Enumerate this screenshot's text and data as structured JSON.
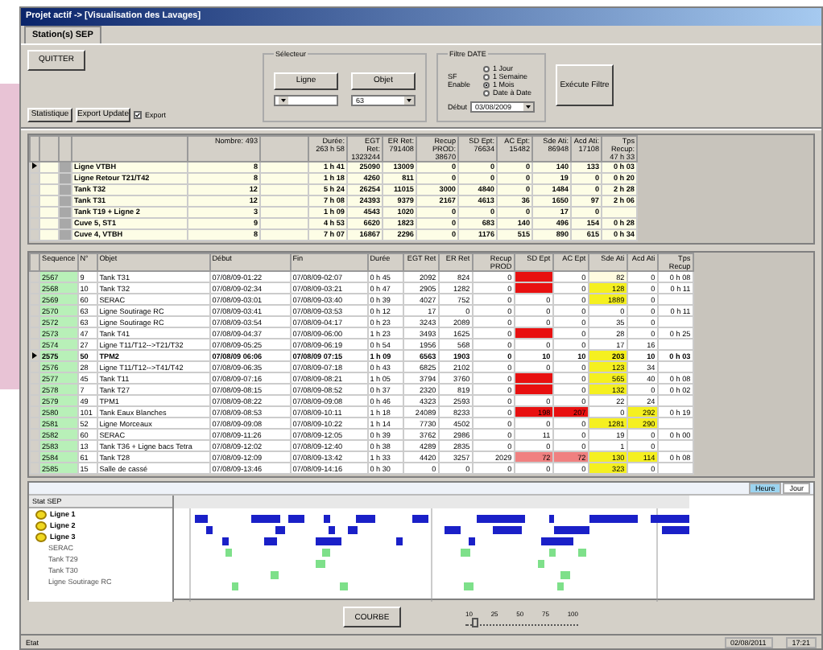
{
  "window": {
    "title": "Projet actif -> [Visualisation des Lavages]"
  },
  "tabs": [
    {
      "label": "Station(s) SEP",
      "selected": true
    }
  ],
  "quit_button": "QUITTER",
  "selector": {
    "title": "Sélecteur",
    "buttons": [
      "Ligne",
      "Objet"
    ],
    "combos": [
      {
        "kind": "blank"
      },
      {
        "kind": "valued",
        "value": "63"
      }
    ]
  },
  "date_filter": {
    "title": "Filtre DATE",
    "enable_label": "SF Enable",
    "options": [
      {
        "label": "1 Jour",
        "selected": false
      },
      {
        "label": "1 Semaine",
        "selected": false
      },
      {
        "label": "1 Mois",
        "selected": true
      },
      {
        "label": "Date à Date",
        "selected": false
      }
    ],
    "start_label": "Début",
    "start_value": "03/08/2009"
  },
  "run_button": "Exécute Filtre",
  "actions": [
    "Statistique",
    "Export Update"
  ],
  "export_checkbox": {
    "label": "Export",
    "checked": true
  },
  "summary_table": {
    "columns": [
      "Nombre: 493",
      "Durée: 263 h 58",
      "EGT Ret: 1323244",
      "ER Ret: 791408",
      "Recup PROD: 38670",
      "SD Ept: 76634",
      "AC Ept: 15482",
      "Sde Ati: 86948",
      "Acd Ati: 17108",
      "Tps Recup: 47 h 33"
    ],
    "rows": [
      {
        "name": "Ligne VTBH",
        "selected": true,
        "values": [
          "8",
          "1 h 41",
          "25090",
          "13009",
          "0",
          "0",
          "0",
          "140",
          "133",
          "0 h 03"
        ]
      },
      {
        "name": "Ligne Retour T21/T42",
        "selected": false,
        "values": [
          "8",
          "1 h 18",
          "4260",
          "811",
          "0",
          "0",
          "0",
          "19",
          "0",
          "0 h 20"
        ]
      },
      {
        "name": "Tank T32",
        "selected": false,
        "values": [
          "12",
          "5 h 24",
          "26254",
          "11015",
          "3000",
          "4840",
          "0",
          "1484",
          "0",
          "2 h 28"
        ]
      },
      {
        "name": "Tank T31",
        "selected": false,
        "values": [
          "12",
          "7 h 08",
          "24393",
          "9379",
          "2167",
          "4613",
          "36",
          "1650",
          "97",
          "2 h 06"
        ]
      },
      {
        "name": "Tank T19 + Ligne 2",
        "selected": false,
        "values": [
          "3",
          "1 h 09",
          "4543",
          "1020",
          "0",
          "0",
          "0",
          "17",
          "0"
        ]
      },
      {
        "name": "Cuve 5, ST1",
        "selected": false,
        "values": [
          "9",
          "4 h 53",
          "6620",
          "1823",
          "0",
          "683",
          "140",
          "496",
          "154",
          "0 h 28"
        ]
      },
      {
        "name": "Cuve 4, VTBH",
        "selected": false,
        "values": [
          "8",
          "7 h 07",
          "16867",
          "2296",
          "0",
          "1176",
          "515",
          "890",
          "615",
          "0 h 34"
        ]
      }
    ]
  },
  "detail_table": {
    "columns": [
      "Sequence",
      "N°",
      "Objet",
      "Début",
      "Fin",
      "Durée",
      "EGT Ret",
      "ER Ret",
      "Recup PROD",
      "SD Ept",
      "AC Ept",
      "Sde Ati",
      "Acd Ati",
      "Tps Recup"
    ],
    "rows": [
      {
        "selected": false,
        "cells": [
          "2567",
          "9",
          "Tank T31",
          "07/08/09-01:22",
          "07/08/09-02:07",
          "0 h 45",
          "2092",
          "824",
          "0",
          {
            "color": "#e81010"
          },
          "0",
          {
            "text": "82",
            "color": "#fffbe0"
          },
          "0",
          "0 h 08"
        ]
      },
      {
        "selected": false,
        "cells": [
          "2568",
          "10",
          "Tank T32",
          "07/08/09-02:34",
          "07/08/09-03:21",
          "0 h 47",
          "2905",
          "1282",
          "0",
          {
            "color": "#e81010"
          },
          "0",
          {
            "text": "128",
            "color": "#f5f020"
          },
          "0",
          "0 h 11"
        ]
      },
      {
        "selected": false,
        "cells": [
          "2569",
          "60",
          "SERAC",
          "07/08/09-03:01",
          "07/08/09-03:40",
          "0 h 39",
          "4027",
          "752",
          "0",
          "0",
          "0",
          {
            "text": "1889",
            "color": "#f5f020"
          },
          "0"
        ]
      },
      {
        "selected": false,
        "cells": [
          "2570",
          "63",
          "Ligne Soutirage RC",
          "07/08/09-03:41",
          "07/08/09-03:53",
          "0 h 12",
          "17",
          "0",
          "0",
          "0",
          "0",
          "0",
          "0",
          "0 h 11"
        ]
      },
      {
        "selected": false,
        "cells": [
          "2572",
          "63",
          "Ligne Soutirage RC",
          "07/08/09-03:54",
          "07/08/09-04:17",
          "0 h 23",
          "3243",
          "2089",
          "0",
          "0",
          "0",
          "35",
          "0"
        ]
      },
      {
        "selected": false,
        "cells": [
          "2573",
          "47",
          "Tank T41",
          "07/08/09-04:37",
          "07/08/09-06:00",
          "1 h 23",
          "3493",
          "1625",
          "0",
          {
            "color": "#e81010"
          },
          "0",
          "28",
          "0",
          "0 h 25"
        ]
      },
      {
        "selected": false,
        "cells": [
          "2574",
          "27",
          "Ligne T11/T12-->T21/T32",
          "07/08/09-05:25",
          "07/08/09-06:19",
          "0 h 54",
          "1956",
          "568",
          "0",
          "0",
          "0",
          "17",
          "16"
        ]
      },
      {
        "selected": true,
        "cells": [
          "2575",
          "50",
          "TPM2",
          "07/08/09 06:06",
          "07/08/09 07:15",
          "1 h 09",
          "6563",
          "1903",
          "0",
          "10",
          "10",
          {
            "text": "203",
            "color": "#f5f020"
          },
          "10",
          "0 h 03"
        ]
      },
      {
        "selected": false,
        "cells": [
          "2576",
          "28",
          "Ligne T11/T12-->T41/T42",
          "07/08/09-06:35",
          "07/08/09-07:18",
          "0 h 43",
          "6825",
          "2102",
          "0",
          "0",
          "0",
          {
            "text": "123",
            "color": "#f5f020"
          },
          "34"
        ]
      },
      {
        "selected": false,
        "cells": [
          "2577",
          "45",
          "Tank T11",
          "07/08/09-07:16",
          "07/08/09-08:21",
          "1 h 05",
          "3794",
          "3760",
          "0",
          {
            "color": "#e81010"
          },
          "0",
          {
            "text": "565",
            "color": "#f5f020"
          },
          "40",
          "0 h 08"
        ]
      },
      {
        "selected": false,
        "cells": [
          "2578",
          "7",
          "Tank T27",
          "07/08/09-08:15",
          "07/08/09-08:52",
          "0 h 37",
          "2320",
          "819",
          "0",
          {
            "color": "#e81010"
          },
          "0",
          {
            "text": "132",
            "color": "#f5f020"
          },
          "0",
          "0 h 02"
        ]
      },
      {
        "selected": false,
        "cells": [
          "2579",
          "49",
          "TPM1",
          "07/08/09-08:22",
          "07/08/09-09:08",
          "0 h 46",
          "4323",
          "2593",
          "0",
          "0",
          "0",
          "22",
          "24"
        ]
      },
      {
        "selected": false,
        "cells": [
          "2580",
          "101",
          "Tank Eaux Blanches",
          "07/08/09-08:53",
          "07/08/09-10:11",
          "1 h 18",
          "24089",
          "8233",
          "0",
          {
            "text": "198",
            "color": "#e81010"
          },
          {
            "text": "207",
            "color": "#e81010"
          },
          "0",
          {
            "text": "292",
            "color": "#f5f020"
          },
          "0 h 19"
        ]
      },
      {
        "selected": false,
        "cells": [
          "2581",
          "52",
          "Ligne Morceaux",
          "07/08/09-09:08",
          "07/08/09-10:22",
          "1 h 14",
          "7730",
          "4502",
          "0",
          "0",
          "0",
          {
            "text": "1281",
            "color": "#f5f020"
          },
          {
            "text": "290",
            "color": "#f5f020"
          }
        ]
      },
      {
        "selected": false,
        "cells": [
          "2582",
          "60",
          "SERAC",
          "07/08/09-11:26",
          "07/08/09-12:05",
          "0 h 39",
          "3762",
          "2986",
          "0",
          "11",
          "0",
          "19",
          "0",
          "0 h 00"
        ]
      },
      {
        "selected": false,
        "cells": [
          "2583",
          "13",
          "Tank T36 + Ligne bacs Tetra",
          "07/08/09-12:02",
          "07/08/09-12:40",
          "0 h 38",
          "4289",
          "2835",
          "0",
          "0",
          "0",
          "1",
          "0"
        ]
      },
      {
        "selected": false,
        "cells": [
          "2584",
          "61",
          "Tank T28",
          "07/08/09-12:09",
          "07/08/09-13:42",
          "1 h 33",
          "4420",
          "3257",
          "2029",
          {
            "text": "72",
            "color": "#f08080"
          },
          {
            "text": "72",
            "color": "#f08080"
          },
          {
            "text": "130",
            "color": "#f5f020"
          },
          {
            "text": "114",
            "color": "#f5f020"
          },
          "0 h 08"
        ]
      },
      {
        "selected": false,
        "cells": [
          "2585",
          "15",
          "Salle de cassé",
          "07/08/09-13:46",
          "07/08/09-14:16",
          "0 h 30",
          "0",
          "0",
          "0",
          "0",
          "0",
          {
            "text": "323",
            "color": "#f5f020"
          },
          "0"
        ]
      }
    ]
  },
  "planning": {
    "scale_tabs": [
      {
        "label": "Heure",
        "selected": true
      },
      {
        "label": "Jour",
        "selected": false
      }
    ],
    "tree": {
      "label": "Stat SEP",
      "children": [
        {
          "label": "Ligne 1"
        },
        {
          "label": "Ligne 2"
        },
        {
          "label": "Ligne 3",
          "children": [
            {
              "label": "SERAC"
            },
            {
              "label": "Tank T29"
            },
            {
              "label": "Tank T30"
            },
            {
              "label": "Ligne Soutirage RC"
            }
          ]
        }
      ]
    }
  },
  "curve_button": "COURBE",
  "zoom_slider": {
    "ticks": [
      "10",
      "25",
      "50",
      "75",
      "100"
    ],
    "level": 0.08
  },
  "status_bar": {
    "left": "Etat",
    "date": "02/08/2011",
    "time": "17:21"
  }
}
